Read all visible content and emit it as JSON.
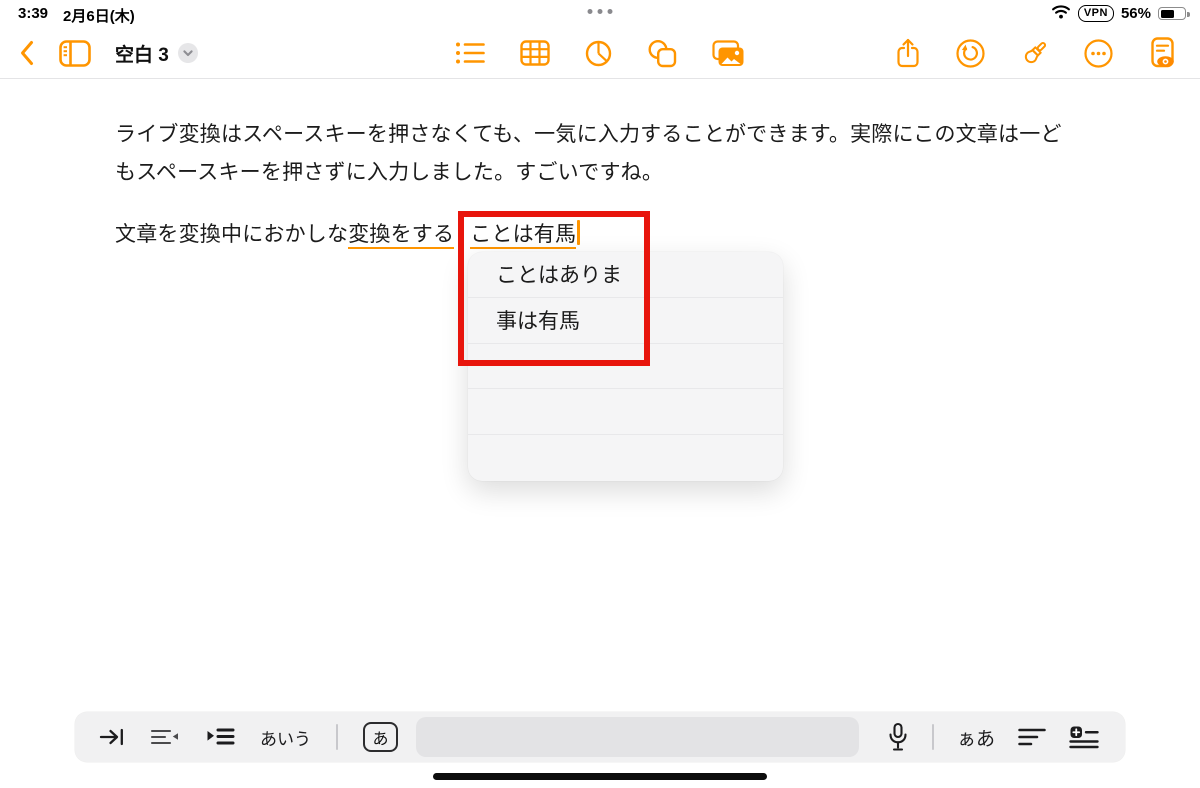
{
  "status_bar": {
    "time": "3:39",
    "date": "2月6日(木)",
    "vpn": "VPN",
    "battery": "56%"
  },
  "toolbar": {
    "title": "空白 3"
  },
  "note": {
    "paragraph1": "ライブ変換はスペースキーを押さなくても、一気に入力することができます。実際にこの文章は一どもスペースキーを押さずに入力しました。すごいですね。",
    "p2_plain": "文章を変換中におかしな",
    "p2_converted": "変換をする",
    "p2_composing": "ことは有馬"
  },
  "candidates": {
    "items": [
      "ことはありま",
      "事は有馬",
      "",
      "",
      ""
    ]
  },
  "keyboard_bar": {
    "kana": "あいう",
    "mode": "あ",
    "textsize": "ぁあ"
  },
  "colors": {
    "accent": "#FF9500",
    "annotation": "#E8150C"
  }
}
